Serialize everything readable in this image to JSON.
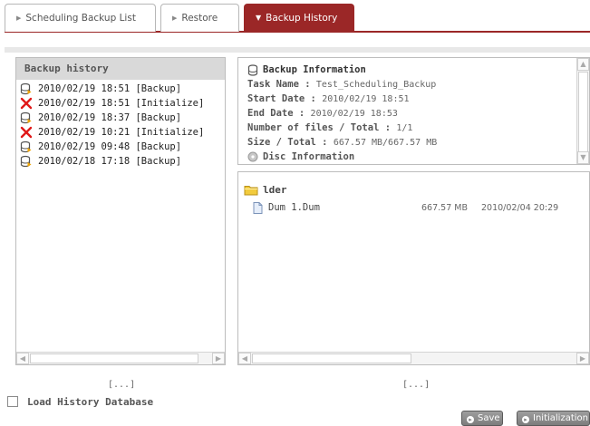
{
  "tabs": [
    {
      "label": "Scheduling Backup List"
    },
    {
      "label": "Restore"
    },
    {
      "label": "Backup History"
    }
  ],
  "history": {
    "title": "Backup history",
    "items": [
      {
        "text": "2010/02/19 18:51 [Backup]",
        "icon": "backup-icon"
      },
      {
        "text": "2010/02/19 18:51 [Initialize]",
        "icon": "error-x-icon"
      },
      {
        "text": "2010/02/19 18:37 [Backup]",
        "icon": "backup-icon"
      },
      {
        "text": "2010/02/19 10:21 [Initialize]",
        "icon": "error-x-icon"
      },
      {
        "text": "2010/02/19 09:48 [Backup]",
        "icon": "backup-icon"
      },
      {
        "text": "2010/02/18 17:18 [Backup]",
        "icon": "backup-icon"
      }
    ]
  },
  "info": {
    "title": "Backup Information",
    "task_label": "Task Name :",
    "task_value": "Test_Scheduling_Backup",
    "start_label": "Start Date :",
    "start_value": "2010/02/19 18:51",
    "end_label": "End Date :",
    "end_value": "2010/02/19 18:53",
    "files_label": "Number of files / Total :",
    "files_value": "1/1",
    "size_label": "Size / Total :",
    "size_value": "667.57 MB/667.57 MB",
    "disc_title": "Disc Information"
  },
  "files": {
    "folder_name": "lder",
    "rows": [
      {
        "name": "Dum 1.Dum",
        "size": "667.57 MB",
        "date": "2010/02/04 20:29"
      }
    ]
  },
  "ellipsis_left": "[...]",
  "ellipsis_right": "[...]",
  "load_history_label": "Load History Database",
  "buttons": {
    "save": "Save",
    "initialization": "Initialization"
  },
  "colors": {
    "accent": "#9b2727",
    "panel_header": "#d9d9d9",
    "button": "#8c8c8c"
  }
}
